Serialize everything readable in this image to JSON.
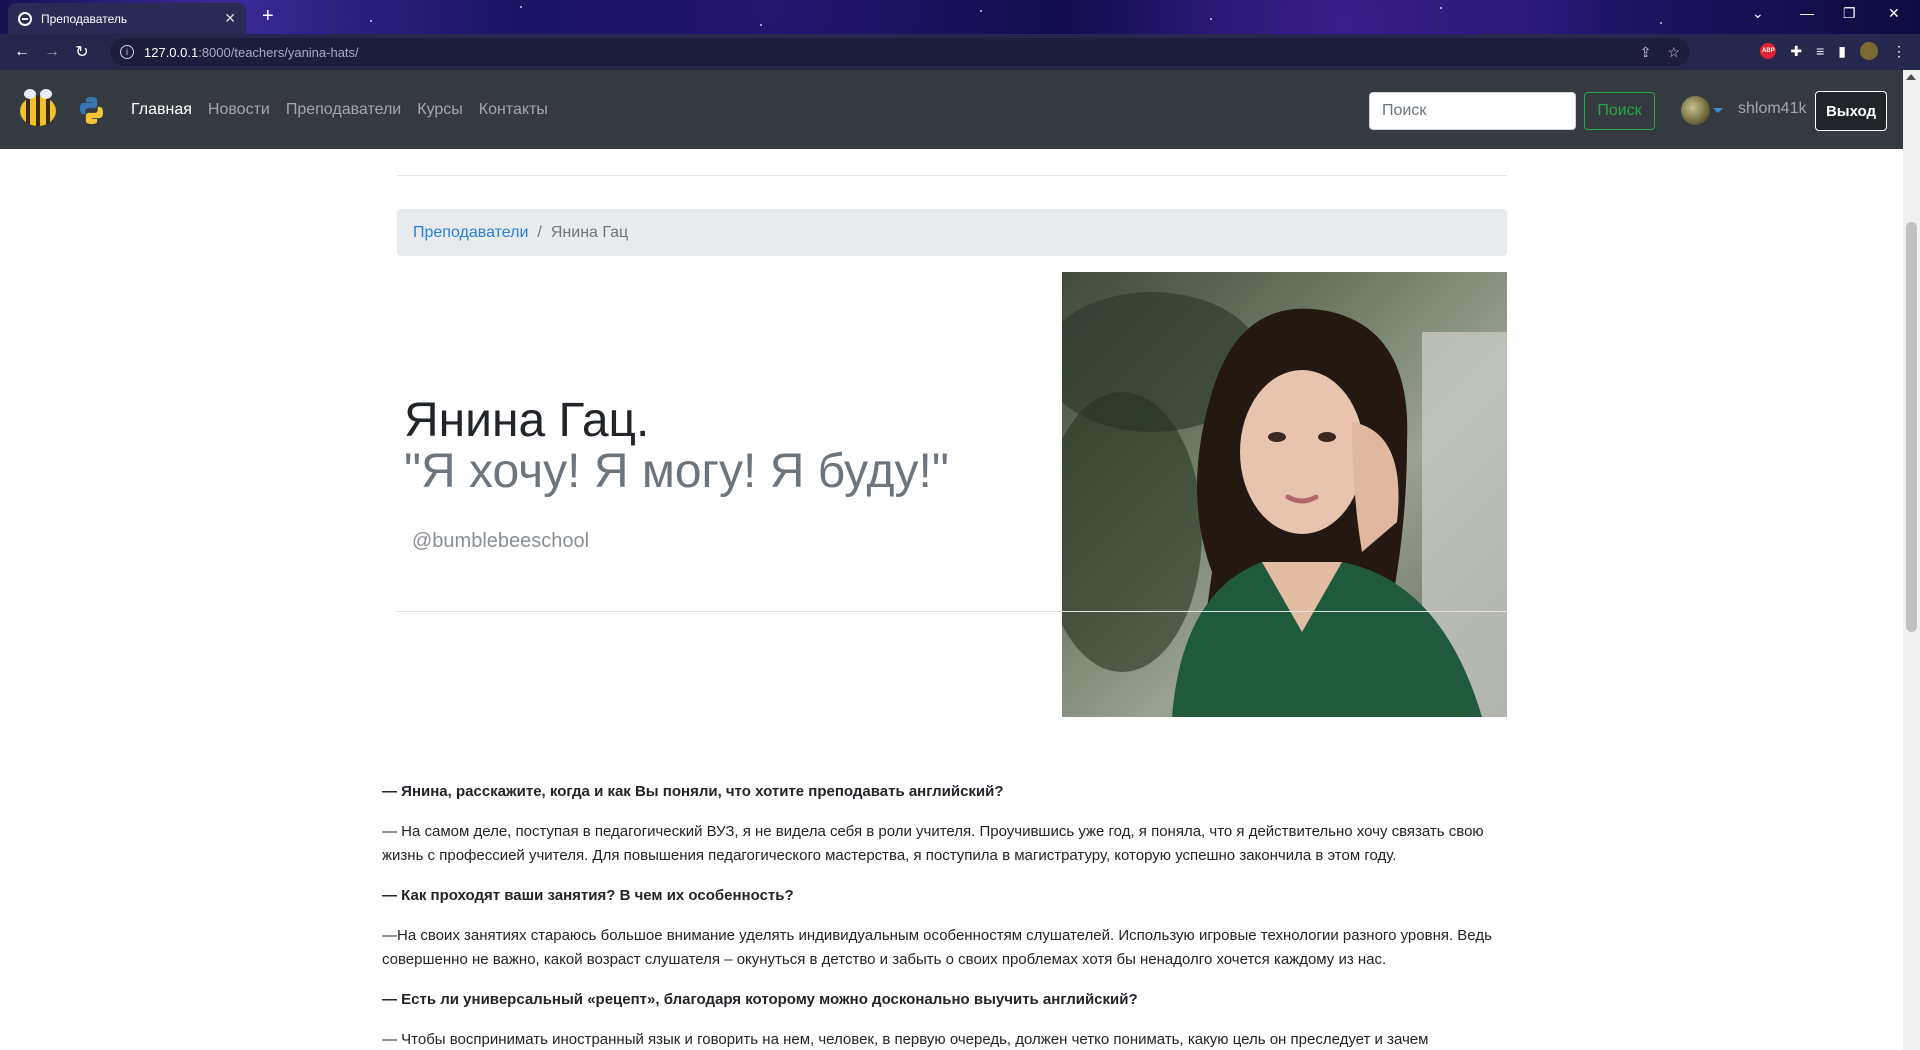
{
  "browser": {
    "tab_title": "Преподаватель",
    "url_host": "127.0.0.1",
    "url_rest": ":8000/teachers/yanina-hats/",
    "abp_label": "ABP"
  },
  "navbar": {
    "links": [
      "Главная",
      "Новости",
      "Преподаватели",
      "Курсы",
      "Контакты"
    ],
    "search_placeholder": "Поиск",
    "search_button": "Поиск",
    "username": "shlom41k",
    "logout": "Выход"
  },
  "breadcrumb": {
    "link": "Преподаватели",
    "separator": "/",
    "current": "Янина Гац"
  },
  "teacher": {
    "name": "Янина Гац.",
    "quote": "\"Я хочу! Я могу! Я буду!\"",
    "handle": "@bumblebeeschool"
  },
  "article": [
    {
      "type": "q",
      "text": "— Янина, расскажите, когда и как Вы поняли, что хотите преподавать английский?"
    },
    {
      "type": "a",
      "text": "— На самом деле, поступая в педагогический ВУЗ, я не видела себя в роли учителя. Проучившись уже год, я поняла, что я действительно хочу связать свою жизнь с профессией учителя. Для повышения педагогического мастерства, я поступила в магистратуру, которую успешно закончила в этом году."
    },
    {
      "type": "q",
      "text": "— Как проходят ваши занятия? В чем их особенность?"
    },
    {
      "type": "a",
      "text": "—На своих занятиях стараюсь большое внимание уделять индивидуальным особенностям слушателей. Использую игровые технологии разного уровня. Ведь совершенно не важно, какой возраст слушателя – окунуться в детство и забыть о своих проблемах хотя бы ненадолго хочется каждому из нас."
    },
    {
      "type": "q",
      "text": "— Есть ли универсальный «рецепт», благодаря которому можно досконально выучить английский?"
    },
    {
      "type": "a",
      "text": "— Чтобы воспринимать иностранный язык и говорить на нем, человек, в первую очередь, должен четко понимать, какую цель он преследует и зачем"
    }
  ],
  "colors": {
    "navbar_bg": "#343a40",
    "link_blue": "#2780d6",
    "success": "#28a745",
    "muted": "#6c757d"
  }
}
